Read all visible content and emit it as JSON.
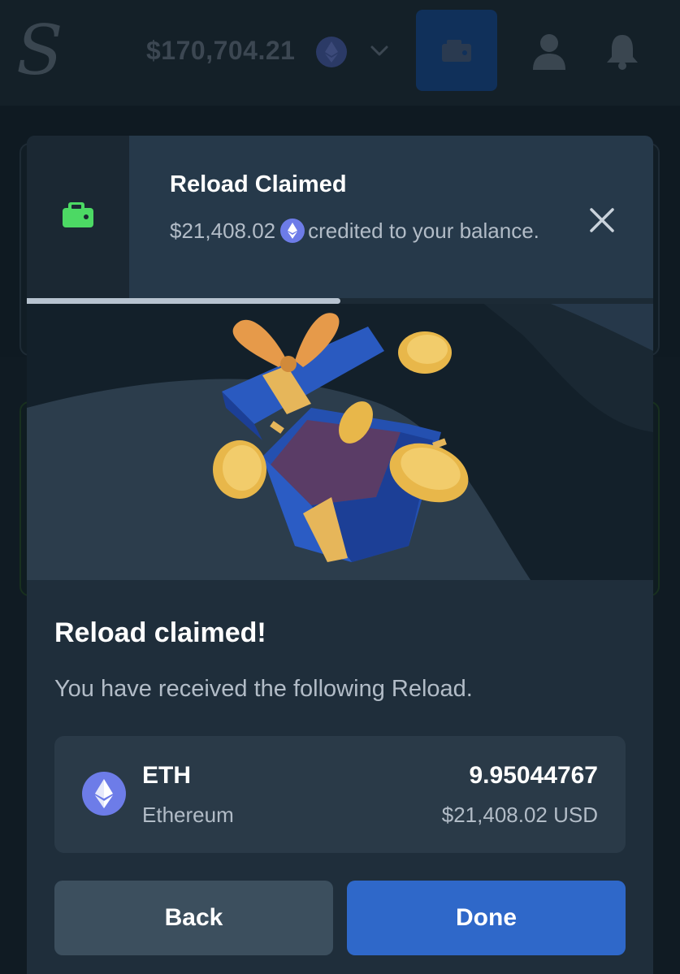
{
  "header": {
    "logo_letter": "S",
    "balance": "$170,704.21",
    "balance_currency_icon": "ethereum-icon"
  },
  "toast": {
    "title": "Reload Claimed",
    "amount": "$21,408.02",
    "message": "credited to your balance.",
    "icon": "wallet-icon",
    "progress_fraction": 0.5
  },
  "modal": {
    "title": "Reload claimed!",
    "subtitle": "You have received the following Reload.",
    "reward": {
      "symbol": "ETH",
      "name": "Ethereum",
      "amount": "9.95044767",
      "usd": "$21,408.02 USD",
      "icon": "ethereum-icon"
    },
    "back_label": "Back",
    "done_label": "Done"
  },
  "colors": {
    "accent_green": "#4cd964",
    "primary_blue": "#2f68c9",
    "eth_purple": "#6d7ce8"
  }
}
